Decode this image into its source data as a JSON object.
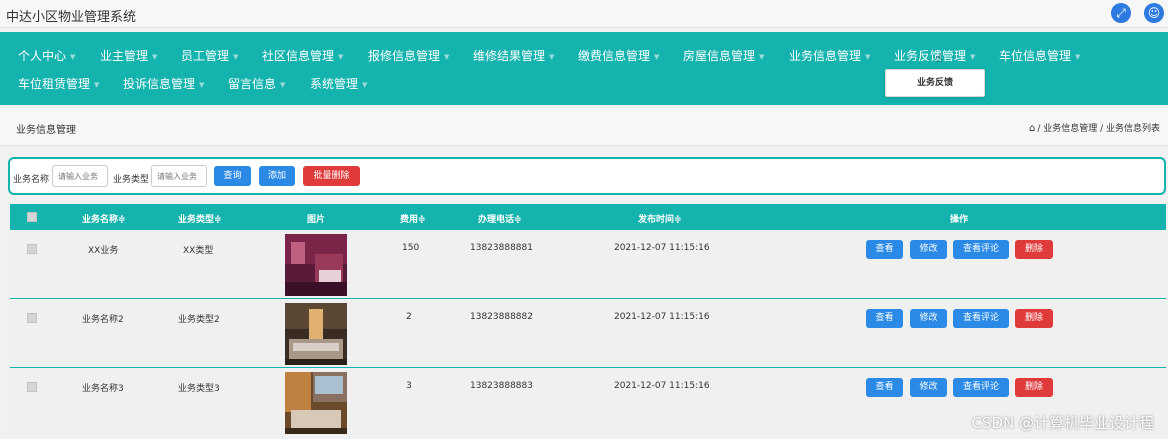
{
  "app": {
    "title": "中达小区物业管理系统"
  },
  "topbar": {
    "fullscreen_icon": "expand-icon",
    "user_icon": "user-icon"
  },
  "nav": {
    "row1": [
      "个人中心",
      "业主管理",
      "员工管理",
      "社区信息管理",
      "报修信息管理",
      "维修结果管理",
      "缴费信息管理",
      "房屋信息管理",
      "业务信息管理",
      "业务反馈管理",
      "车位信息管理"
    ],
    "row2": [
      "车位租赁管理",
      "投诉信息管理",
      "留言信息",
      "系统管理"
    ],
    "dropdown_item": "业务反馈"
  },
  "breadcrumb": {
    "page_title": "业务信息管理",
    "trail": "/ 业务信息管理 / 业务信息列表"
  },
  "search": {
    "name_label": "业务名称",
    "name_placeholder": "请输入业务",
    "type_label": "业务类型",
    "type_placeholder": "请输入业务",
    "query_btn": "查询",
    "add_btn": "添加",
    "batch_delete_btn": "批量删除"
  },
  "table": {
    "headers": [
      "业务名称≑",
      "业务类型≑",
      "图片",
      "费用≑",
      "办理电话≑",
      "发布时间≑",
      "操作"
    ],
    "rows": [
      {
        "name": "XX业务",
        "type": "XX类型",
        "fee": "150",
        "phone": "13823888881",
        "time": "2021-12-07 11:15:16"
      },
      {
        "name": "业务名称2",
        "type": "业务类型2",
        "fee": "2",
        "phone": "13823888882",
        "time": "2021-12-07 11:15:16"
      },
      {
        "name": "业务名称3",
        "type": "业务类型3",
        "fee": "3",
        "phone": "13823888883",
        "time": "2021-12-07 11:15:16"
      }
    ],
    "actions": {
      "view": "查看",
      "edit": "修改",
      "comments": "查看评论",
      "delete": "删除"
    }
  },
  "watermark": "CSDN @计算机毕业设计程",
  "colors": {
    "primary": "#15b3ae",
    "blue": "#2a8ae6",
    "red": "#e03b3b"
  }
}
